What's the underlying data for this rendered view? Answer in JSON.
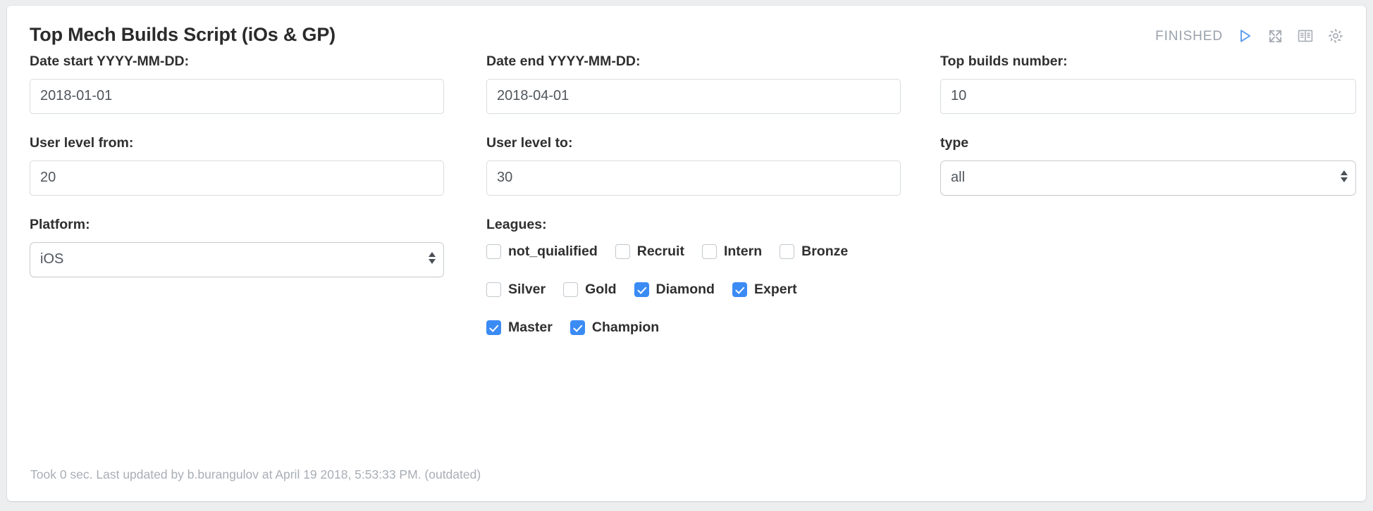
{
  "header": {
    "title": "Top Mech Builds Script (iOs & GP)",
    "status": "FINISHED",
    "icons": {
      "run": "play-icon",
      "expand": "expand-arrows-icon",
      "docs": "book-icon",
      "settings": "gear-icon"
    }
  },
  "fields": {
    "date_start": {
      "label": "Date start YYYY-MM-DD:",
      "value": "2018-01-01"
    },
    "date_end": {
      "label": "Date end YYYY-MM-DD:",
      "value": "2018-04-01"
    },
    "top_builds": {
      "label": "Top builds number:",
      "value": "10"
    },
    "level_from": {
      "label": "User level from:",
      "value": "20"
    },
    "level_to": {
      "label": "User level to:",
      "value": "30"
    },
    "type": {
      "label": "type",
      "value": "all"
    },
    "platform": {
      "label": "Platform:",
      "value": "iOS"
    }
  },
  "leagues": {
    "label": "Leagues:",
    "rows": [
      [
        {
          "label": "not_quialified",
          "checked": false
        },
        {
          "label": "Recruit",
          "checked": false
        },
        {
          "label": "Intern",
          "checked": false
        },
        {
          "label": "Bronze",
          "checked": false
        }
      ],
      [
        {
          "label": "Silver",
          "checked": false
        },
        {
          "label": "Gold",
          "checked": false
        },
        {
          "label": "Diamond",
          "checked": true
        },
        {
          "label": "Expert",
          "checked": true
        }
      ],
      [
        {
          "label": "Master",
          "checked": true
        },
        {
          "label": "Champion",
          "checked": true
        }
      ]
    ]
  },
  "footer": {
    "note": "Took 0 sec. Last updated by b.burangulov at April 19 2018, 5:53:33 PM. (outdated)"
  },
  "colors": {
    "accent": "#3b8bf5",
    "play": "#5b9bf0",
    "status": "#9aa2ab",
    "page_bg": "#eceef0",
    "card_bg": "#ffffff"
  }
}
